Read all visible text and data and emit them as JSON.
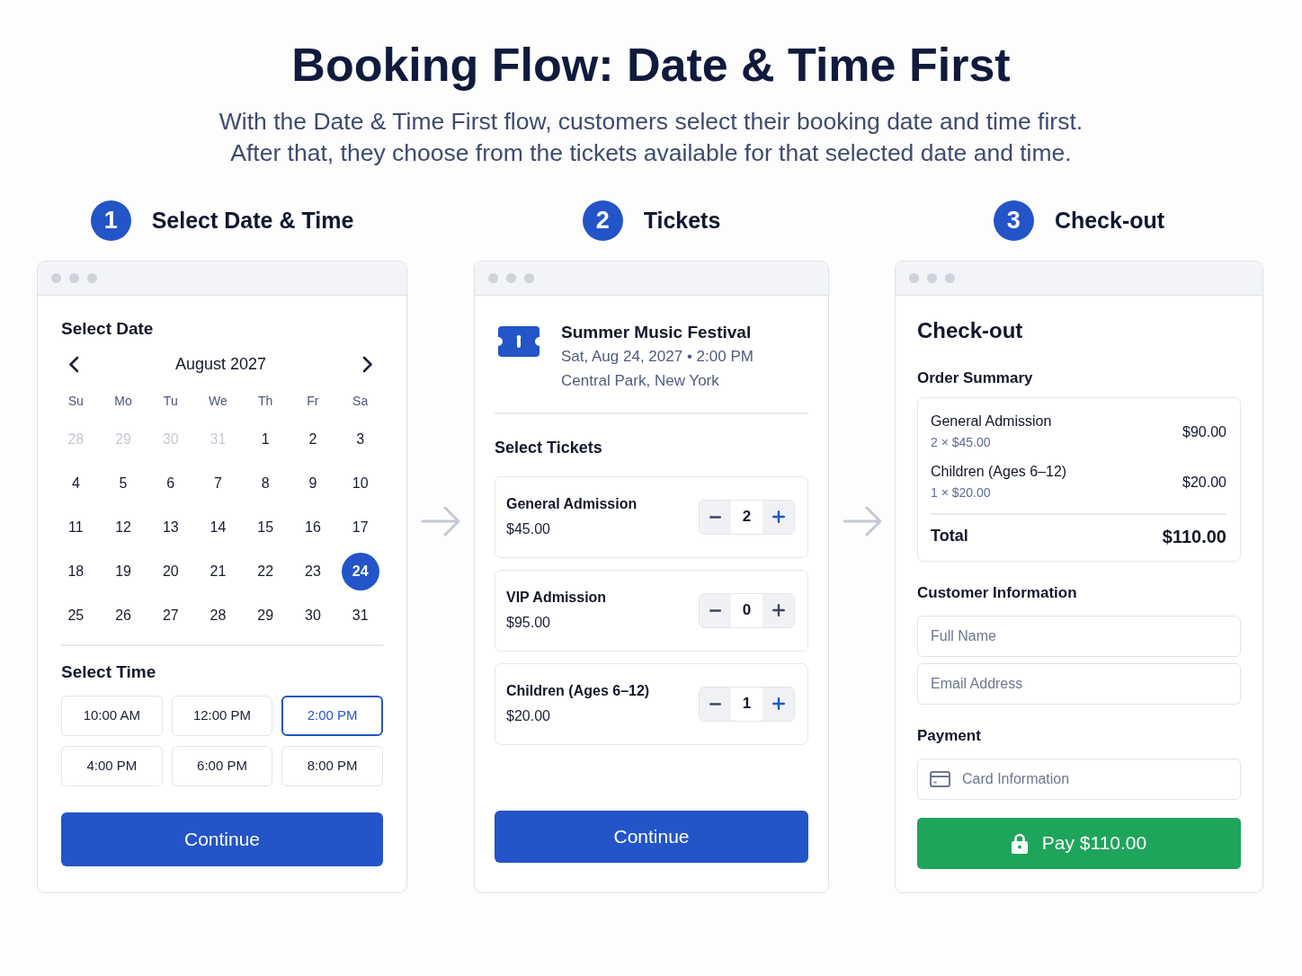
{
  "title": "Booking Flow: Date & Time First",
  "subtitle": [
    "With the Date & Time First flow, customers select their booking date and time first.",
    "After that, they choose from the tickets available for that selected date and time."
  ],
  "steps": [
    {
      "number": "1",
      "label": "Select Date & Time"
    },
    {
      "number": "2",
      "label": "Tickets"
    },
    {
      "number": "3",
      "label": "Check-out"
    }
  ],
  "date_time_panel": {
    "date_heading": "Select Date",
    "month": "August 2027",
    "weekdays": [
      "Su",
      "Mo",
      "Tu",
      "We",
      "Th",
      "Fr",
      "Sa"
    ],
    "days": [
      {
        "label": "28",
        "outside": true,
        "selected": false
      },
      {
        "label": "29",
        "outside": true,
        "selected": false
      },
      {
        "label": "30",
        "outside": true,
        "selected": false
      },
      {
        "label": "31",
        "outside": true,
        "selected": false
      },
      {
        "label": "1",
        "outside": false,
        "selected": false
      },
      {
        "label": "2",
        "outside": false,
        "selected": false
      },
      {
        "label": "3",
        "outside": false,
        "selected": false
      },
      {
        "label": "4",
        "outside": false,
        "selected": false
      },
      {
        "label": "5",
        "outside": false,
        "selected": false
      },
      {
        "label": "6",
        "outside": false,
        "selected": false
      },
      {
        "label": "7",
        "outside": false,
        "selected": false
      },
      {
        "label": "8",
        "outside": false,
        "selected": false
      },
      {
        "label": "9",
        "outside": false,
        "selected": false
      },
      {
        "label": "10",
        "outside": false,
        "selected": false
      },
      {
        "label": "11",
        "outside": false,
        "selected": false
      },
      {
        "label": "12",
        "outside": false,
        "selected": false
      },
      {
        "label": "13",
        "outside": false,
        "selected": false
      },
      {
        "label": "14",
        "outside": false,
        "selected": false
      },
      {
        "label": "15",
        "outside": false,
        "selected": false
      },
      {
        "label": "16",
        "outside": false,
        "selected": false
      },
      {
        "label": "17",
        "outside": false,
        "selected": false
      },
      {
        "label": "18",
        "outside": false,
        "selected": false
      },
      {
        "label": "19",
        "outside": false,
        "selected": false
      },
      {
        "label": "20",
        "outside": false,
        "selected": false
      },
      {
        "label": "21",
        "outside": false,
        "selected": false
      },
      {
        "label": "22",
        "outside": false,
        "selected": false
      },
      {
        "label": "23",
        "outside": false,
        "selected": false
      },
      {
        "label": "24",
        "outside": false,
        "selected": true
      },
      {
        "label": "25",
        "outside": false,
        "selected": false
      },
      {
        "label": "26",
        "outside": false,
        "selected": false
      },
      {
        "label": "27",
        "outside": false,
        "selected": false
      },
      {
        "label": "28",
        "outside": false,
        "selected": false
      },
      {
        "label": "29",
        "outside": false,
        "selected": false
      },
      {
        "label": "30",
        "outside": false,
        "selected": false
      },
      {
        "label": "31",
        "outside": false,
        "selected": false
      }
    ],
    "time_heading": "Select Time",
    "times": [
      {
        "label": "10:00 AM",
        "selected": false
      },
      {
        "label": "12:00 PM",
        "selected": false
      },
      {
        "label": "2:00 PM",
        "selected": true
      },
      {
        "label": "4:00 PM",
        "selected": false
      },
      {
        "label": "6:00 PM",
        "selected": false
      },
      {
        "label": "8:00 PM",
        "selected": false
      }
    ],
    "button": "Continue"
  },
  "tickets_panel": {
    "event": {
      "name": "Summer Music Festival",
      "datetime": "Sat, Aug 24, 2027 • 2:00 PM",
      "location": "Central Park, New York"
    },
    "heading": "Select Tickets",
    "tickets": [
      {
        "name": "General Admission",
        "price": "$45.00",
        "quantity": "2",
        "active": true
      },
      {
        "name": "VIP Admission",
        "price": "$95.00",
        "quantity": "0",
        "active": false
      },
      {
        "name": "Children (Ages 6–12)",
        "price": "$20.00",
        "quantity": "1",
        "active": true
      }
    ],
    "button": "Continue"
  },
  "checkout_panel": {
    "title": "Check-out",
    "summary_heading": "Order Summary",
    "items": [
      {
        "name": "General Admission",
        "detail": "2 × $45.00",
        "amount": "$90.00"
      },
      {
        "name": "Children (Ages 6–12)",
        "detail": "1 × $20.00",
        "amount": "$20.00"
      }
    ],
    "total_label": "Total",
    "total": "$110.00",
    "customer_heading": "Customer Information",
    "fields": [
      {
        "placeholder": "Full Name"
      },
      {
        "placeholder": "Email Address"
      }
    ],
    "payment_heading": "Payment",
    "card_field": {
      "placeholder": "Card Information"
    },
    "pay_button": "Pay $110.00"
  }
}
